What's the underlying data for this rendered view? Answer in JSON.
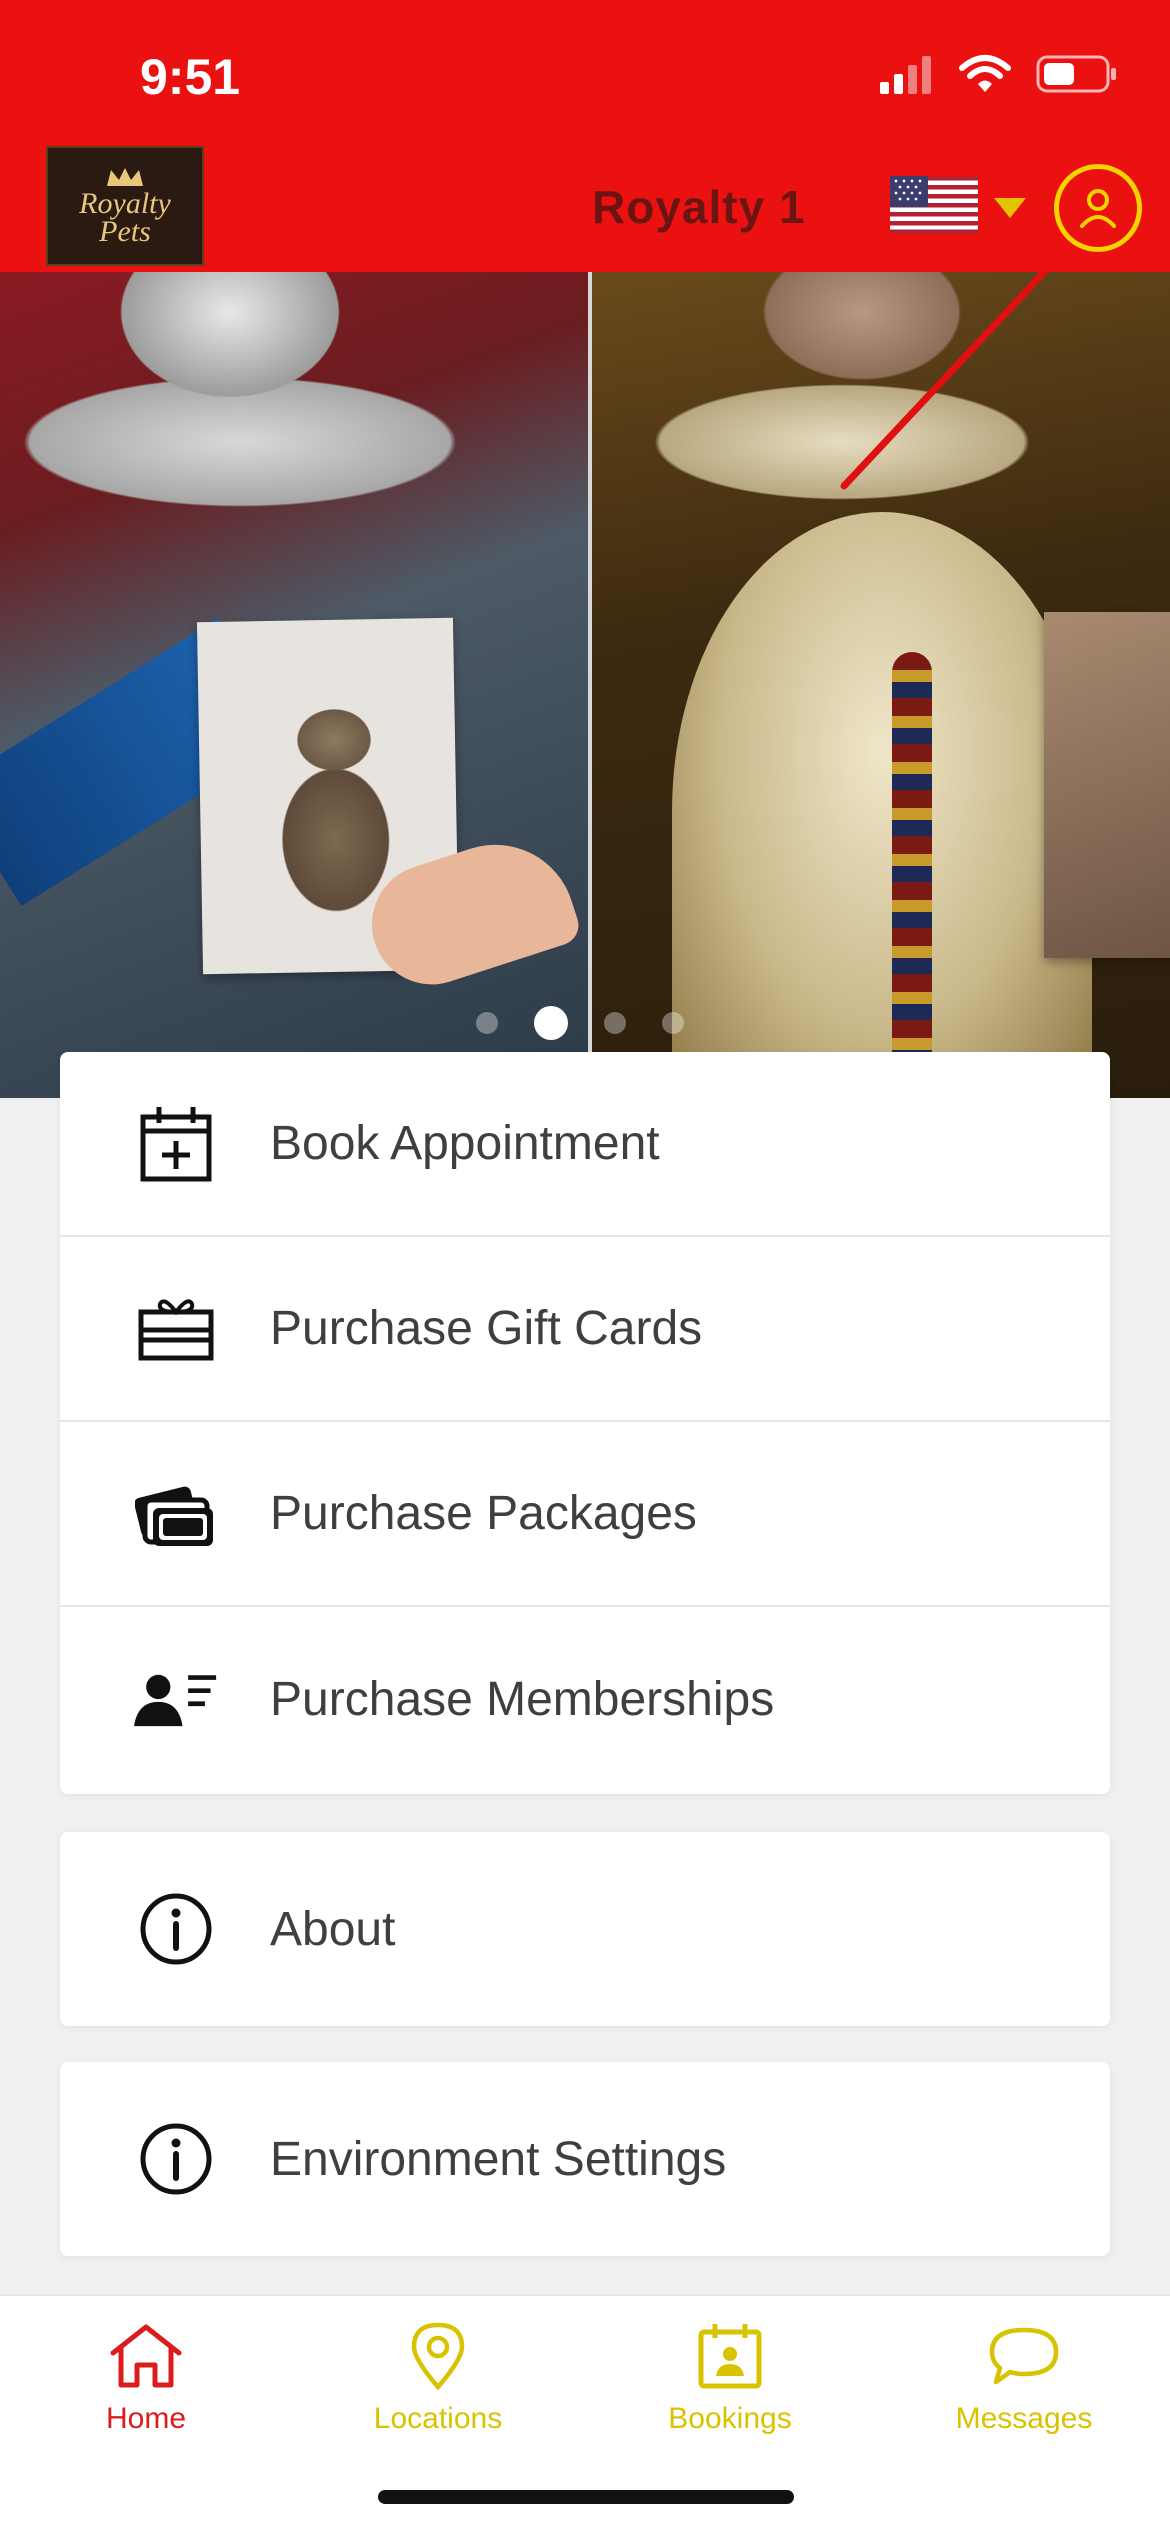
{
  "status_bar": {
    "time": "9:51"
  },
  "header": {
    "logo_text_line1": "Royalty",
    "logo_text_line2": "Pets",
    "account_name": "Royalty 1",
    "language": "US",
    "colors": {
      "background": "#ec1111",
      "accent": "#f2d400",
      "title": "#6b1512"
    }
  },
  "carousel": {
    "total_slides": 4,
    "active_slide": 2
  },
  "menu": {
    "items": [
      {
        "label": "Book Appointment",
        "icon": "calendar-plus-icon"
      },
      {
        "label": "Purchase Gift Cards",
        "icon": "gift-card-icon"
      },
      {
        "label": "Purchase Packages",
        "icon": "stacked-cards-icon"
      },
      {
        "label": "Purchase Memberships",
        "icon": "member-list-icon"
      }
    ],
    "about_label": "About",
    "environment_label": "Environment Settings"
  },
  "tabbar": {
    "tabs": [
      {
        "label": "Home",
        "icon": "home-icon",
        "active": true,
        "color": "#dc1c1c"
      },
      {
        "label": "Locations",
        "icon": "location-pin-icon",
        "active": false,
        "color": "#d9c200"
      },
      {
        "label": "Bookings",
        "icon": "bookings-calendar-icon",
        "active": false,
        "color": "#d9c200"
      },
      {
        "label": "Messages",
        "icon": "chat-bubble-icon",
        "active": false,
        "color": "#d9c200"
      }
    ]
  }
}
